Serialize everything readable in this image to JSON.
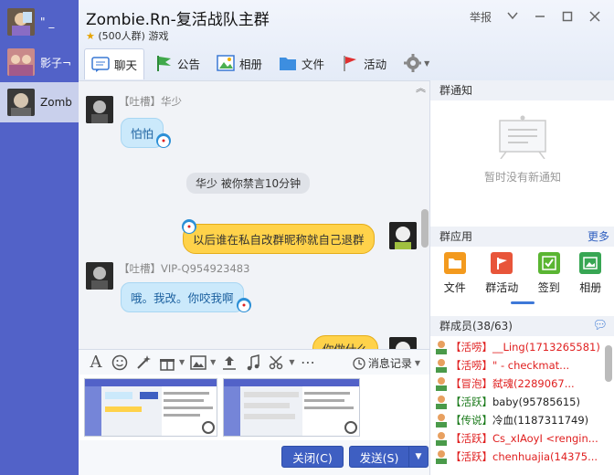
{
  "sidebar": {
    "items": [
      {
        "label": "\" _"
      },
      {
        "label": "影子¬"
      },
      {
        "label": "Zomb"
      }
    ]
  },
  "header": {
    "title": "Zombie.Rn-复活战队主群",
    "subtitle": "(500人群) 游戏",
    "report_label": "举报",
    "tabs": [
      {
        "label": "聊天"
      },
      {
        "label": "公告"
      },
      {
        "label": "相册"
      },
      {
        "label": "文件"
      },
      {
        "label": "活动"
      }
    ]
  },
  "chat": {
    "messages": [
      {
        "tag": "【吐槽】",
        "sender": "华少",
        "text": "怕怕"
      },
      {
        "system": "华少 被你禁言10分钟"
      },
      {
        "text_mine": "以后谁在私自改群昵称就自己退群"
      },
      {
        "tag": "【吐槽】",
        "sender": "VIP-Q954923483",
        "text": "哦。我改。你咬我啊"
      },
      {
        "text_mine_partial": "你做什么"
      }
    ]
  },
  "input": {
    "history_label": "消息记录",
    "close_label": "关闭(C)",
    "send_label": "发送(S)"
  },
  "right_panel": {
    "notice_title": "群通知",
    "notice_empty": "暂时没有新通知",
    "apps_title": "群应用",
    "apps_more": "更多",
    "apps": [
      {
        "label": "文件",
        "color": "#f39a1e"
      },
      {
        "label": "群活动",
        "color": "#e8553a"
      },
      {
        "label": "签到",
        "color": "#5ab532"
      },
      {
        "label": "相册",
        "color": "#37a653"
      }
    ],
    "members_title": "群成员(38/63)",
    "members": [
      {
        "badge": "【活唠】",
        "name": "__Ling(1713265581)",
        "red_name": true
      },
      {
        "badge": "【活唠】",
        "name": "\" -      checkmat...",
        "red_name": true
      },
      {
        "badge": "【冒泡】",
        "name": "弑魂(2289067...",
        "red_name": true
      },
      {
        "badge": "【活跃】",
        "name": "baby(95785615)",
        "red_name": false,
        "badge_green": true
      },
      {
        "badge": "【传说】",
        "name": "冷血(1187311749)",
        "red_name": false,
        "badge_green": true
      },
      {
        "badge": "【活跃】",
        "name": "Cs_xIAoyI <rengin...",
        "red_name": true
      },
      {
        "badge": "【活跃】",
        "name": "chenhuajia(14375...",
        "red_name": true
      }
    ]
  }
}
